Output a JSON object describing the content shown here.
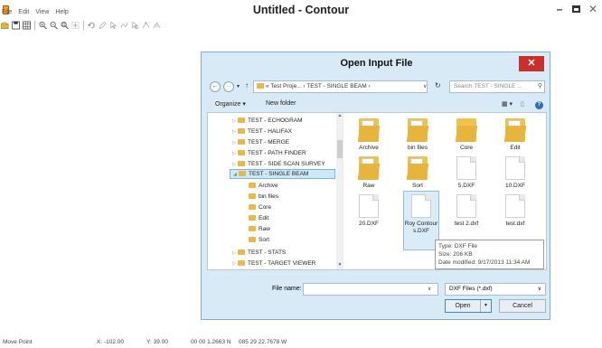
{
  "app": {
    "title": "Untitled - Contour",
    "menu": [
      "File",
      "Edit",
      "View",
      "Help"
    ],
    "window_controls": {
      "minimize": "–",
      "close": "✕"
    }
  },
  "dialog": {
    "title": "Open Input File",
    "close": "✕",
    "nav": {
      "back": "←",
      "forward": "→",
      "recent": "▾",
      "up": "↑"
    },
    "address": "« Test Proje... › TEST - SINGLE BEAM ›",
    "address_dropdown": "∨",
    "refresh": "↻",
    "search_placeholder": "Search TEST - SINGLE ...",
    "search_icon": "⚲",
    "organize": "Organize ▾",
    "new_folder": "New folder",
    "view_controls": {
      "change_view": "▦ ▾",
      "preview_pane": "▯",
      "help": "?"
    },
    "tree": [
      {
        "label": "TEST - ECHOGRAM",
        "arrow": "▷"
      },
      {
        "label": "TEST - HALIFAX",
        "arrow": "▷"
      },
      {
        "label": "TEST - MERGE",
        "arrow": "▷"
      },
      {
        "label": "TEST - PATH FINDER",
        "arrow": "▷"
      },
      {
        "label": "TEST - SIDE SCAN SURVEY",
        "arrow": "▷"
      },
      {
        "label": "TEST - SINGLE BEAM",
        "arrow": "◢"
      },
      {
        "label": "Archive",
        "arrow": ""
      },
      {
        "label": "bin files",
        "arrow": ""
      },
      {
        "label": "Core",
        "arrow": ""
      },
      {
        "label": "Edit",
        "arrow": ""
      },
      {
        "label": "Raw",
        "arrow": ""
      },
      {
        "label": "Sort",
        "arrow": ""
      },
      {
        "label": "TEST - STATS",
        "arrow": "▷"
      },
      {
        "label": "TEST - TARGET VIEWER",
        "arrow": "▷"
      }
    ],
    "files": [
      {
        "label": "Archive",
        "kind": "folder"
      },
      {
        "label": "bin files",
        "kind": "folder"
      },
      {
        "label": "Core",
        "kind": "folder"
      },
      {
        "label": "Edit",
        "kind": "folder"
      },
      {
        "label": "Raw",
        "kind": "folder"
      },
      {
        "label": "Sort",
        "kind": "folder"
      },
      {
        "label": "5.DXF",
        "kind": "doc"
      },
      {
        "label": "10.DXF",
        "kind": "doc"
      },
      {
        "label": "20.DXF",
        "kind": "doc"
      },
      {
        "label": "Roy Contours.DXF",
        "kind": "doc"
      },
      {
        "label": "test 2.dxf",
        "kind": "doc"
      },
      {
        "label": "test.dxf",
        "kind": "doc"
      }
    ],
    "tooltip": {
      "type": "Type: DXF File",
      "size": "Size: 206 KB",
      "modified": "Date modified: 9/17/2013 11:34 AM"
    },
    "file_name_label": "File name:",
    "file_name_value": "",
    "file_type": "DXF Files (*.dxf)",
    "open_button": "Open",
    "cancel_button": "Cancel"
  },
  "status": {
    "mode": "Move Point",
    "x": "X: -102.00",
    "y": "Y: 39.00",
    "lat": "00 00 1.2663 N",
    "lon": "085 29 22.7678 W"
  }
}
